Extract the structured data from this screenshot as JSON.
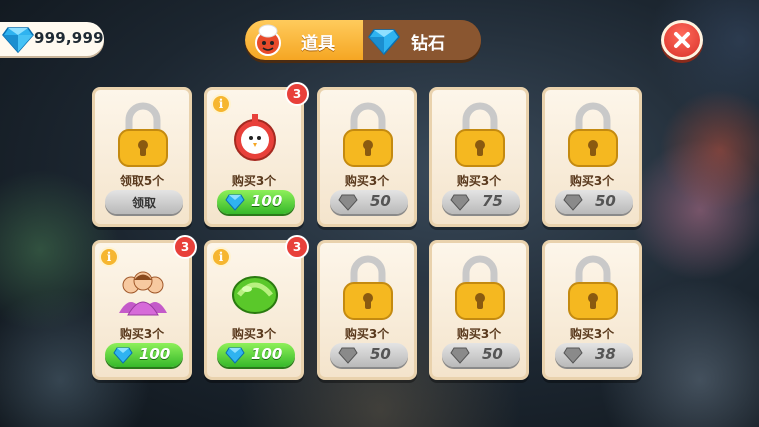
{
  "currency": {
    "diamond_count": "999,999",
    "icon": "diamond-icon"
  },
  "tabs": [
    {
      "label": "道具",
      "icon": "chef-tomato-icon",
      "active": true
    },
    {
      "label": "钻石",
      "icon": "diamond-icon",
      "active": false
    }
  ],
  "close": {
    "icon": "close-icon"
  },
  "colors": {
    "green_button": "#36b82a",
    "grey_button": "#b9b9b9",
    "badge_red": "#e8403a",
    "card_bg": "#fdf6ea",
    "tab_active": "#f5a623"
  },
  "cards": [
    {
      "type": "locked",
      "label": "领取5个",
      "button_type": "text",
      "button_text": "领取"
    },
    {
      "type": "item",
      "item_icon": "chicken-timer-icon",
      "badge": "3",
      "info": "i",
      "label": "购买3个",
      "button_type": "green",
      "price": "100"
    },
    {
      "type": "locked",
      "label": "购买3个",
      "button_type": "grey",
      "price": "50"
    },
    {
      "type": "locked",
      "label": "购买3个",
      "button_type": "grey",
      "price": "75"
    },
    {
      "type": "locked",
      "label": "购买3个",
      "button_type": "grey",
      "price": "50"
    },
    {
      "type": "item",
      "item_icon": "customers-group-icon",
      "badge": "3",
      "info": "i",
      "label": "购买3个",
      "button_type": "green",
      "price": "100"
    },
    {
      "type": "item",
      "item_icon": "green-candy-icon",
      "badge": "3",
      "info": "i",
      "label": "购买3个",
      "button_type": "green",
      "price": "100"
    },
    {
      "type": "locked",
      "label": "购买3个",
      "button_type": "grey",
      "price": "50"
    },
    {
      "type": "locked",
      "label": "购买3个",
      "button_type": "grey",
      "price": "50"
    },
    {
      "type": "locked",
      "label": "购买3个",
      "button_type": "grey",
      "price": "38"
    }
  ]
}
